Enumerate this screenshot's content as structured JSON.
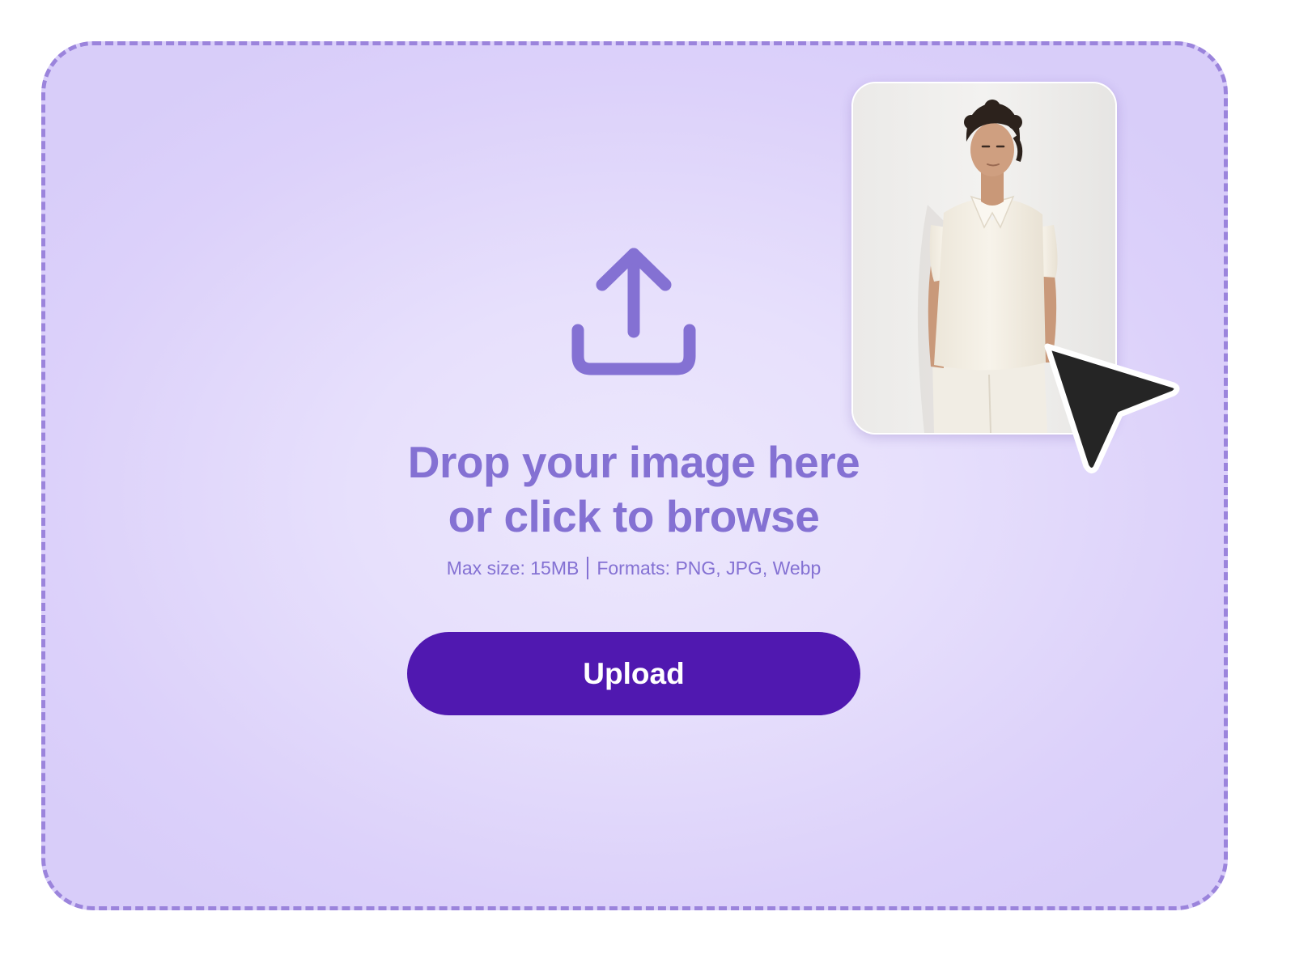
{
  "dropzone": {
    "headline_line1": "Drop your image here",
    "headline_line2": "or click to browse",
    "max_size": "Max size: 15MB",
    "formats": "Formats: PNG, JPG, Webp",
    "upload_label": "Upload"
  },
  "icons": {
    "upload": "upload-icon",
    "cursor": "cursor-arrow-icon"
  },
  "colors": {
    "accent": "#8471d3",
    "button": "#5018b0",
    "border": "#9b84dc",
    "background": "#e7e0fc"
  }
}
